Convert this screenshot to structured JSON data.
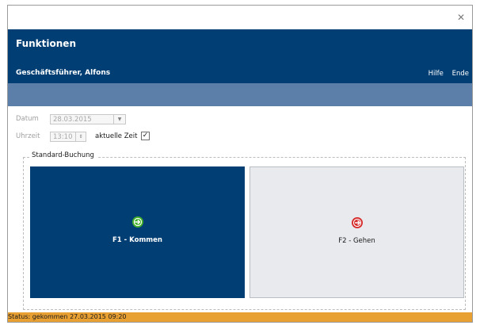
{
  "window": {
    "close_glyph": "✕"
  },
  "header": {
    "title": "Funktionen",
    "user": "Geschäftsführer, Alfons",
    "help_label": "Hilfe",
    "exit_label": "Ende"
  },
  "form": {
    "date_label": "Datum",
    "date_value": "28.03.2015",
    "time_label": "Uhrzeit",
    "time_value": "13:10",
    "now_label": "aktuelle Zeit",
    "now_checked": true
  },
  "booking": {
    "group_label": "Standard-Buchung",
    "in_label": "F1 - Kommen",
    "out_label": "F2 - Gehen"
  },
  "status": {
    "text": "Status: gekommen 27.03.2015 09:20"
  },
  "colors": {
    "header_bg": "#003e74",
    "subbar_bg": "#5b7fa8",
    "tile_in_bg": "#003e74",
    "tile_out_bg": "#e8eaee",
    "status_bg": "#e8a033",
    "icon_in": "#43b02a",
    "icon_out": "#d62d2d"
  },
  "icons": {
    "in": "arrow-right-circle-icon",
    "out": "exit-circle-icon"
  }
}
